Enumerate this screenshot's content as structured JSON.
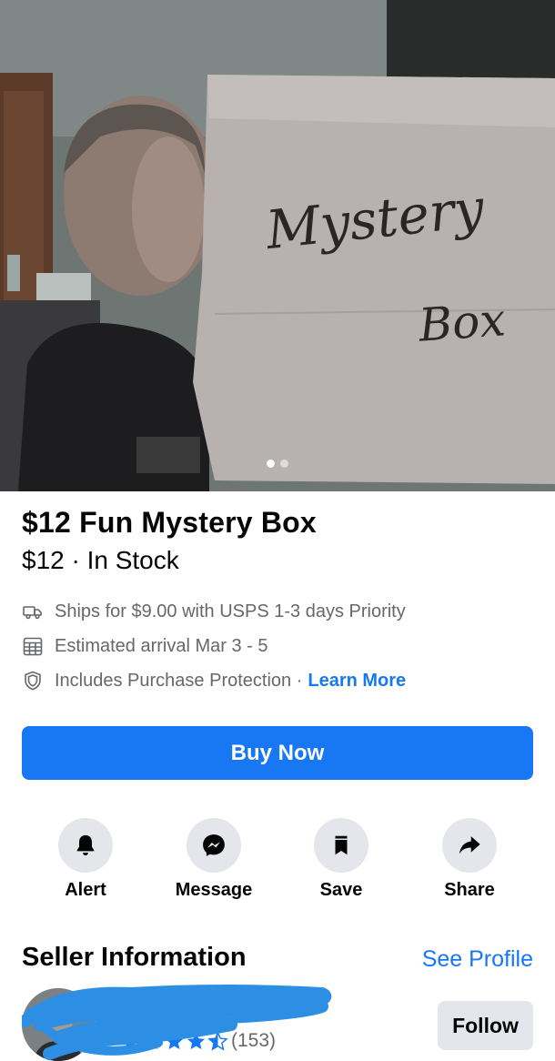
{
  "listing": {
    "title": "$12 Fun Mystery Box",
    "price_line": "$12 · In Stock",
    "image": {
      "box_text_line1": "Mystery",
      "box_text_line2": "Box",
      "slide_count": 2,
      "active_slide": 1
    }
  },
  "details": {
    "shipping": "Ships for $9.00 with USPS 1-3 days Priority",
    "arrival": "Estimated arrival Mar 3 - 5",
    "protection": "Includes Purchase Protection ·",
    "learn_more": "Learn More"
  },
  "buy_button": "Buy Now",
  "actions": [
    {
      "label": "Alert",
      "icon": "bell-icon"
    },
    {
      "label": "Message",
      "icon": "messenger-icon"
    },
    {
      "label": "Save",
      "icon": "bookmark-icon"
    },
    {
      "label": "Share",
      "icon": "share-arrow-icon"
    }
  ],
  "seller": {
    "heading": "Seller Information",
    "see_profile": "See Profile",
    "rating": 4.5,
    "review_count": "(153)",
    "follow": "Follow"
  },
  "colors": {
    "accent": "#1877f2",
    "secondary_text": "#65676b",
    "button_gray": "#e4e6eb",
    "redaction_blue": "#2d8fe3"
  }
}
